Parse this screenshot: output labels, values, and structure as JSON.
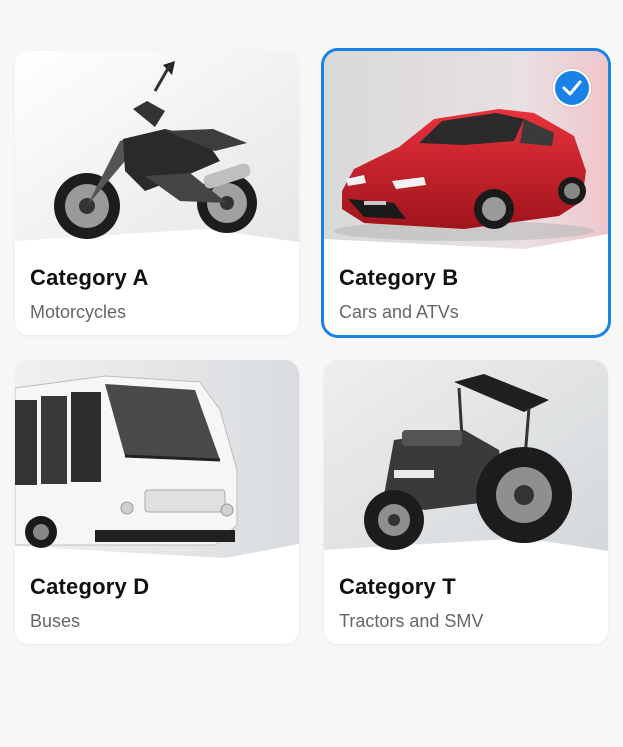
{
  "categories": [
    {
      "title": "Category A",
      "subtitle": "Motorcycles",
      "icon": "motorcycle-photo",
      "selected": false
    },
    {
      "title": "Category B",
      "subtitle": "Cars and ATVs",
      "icon": "car-photo",
      "selected": true
    },
    {
      "title": "Category D",
      "subtitle": "Buses",
      "icon": "bus-photo",
      "selected": false
    },
    {
      "title": "Category T",
      "subtitle": "Tractors and SMV",
      "icon": "tractor-photo",
      "selected": false
    }
  ],
  "colors": {
    "accent": "#1a82e6",
    "car_red": "#d3202a"
  }
}
